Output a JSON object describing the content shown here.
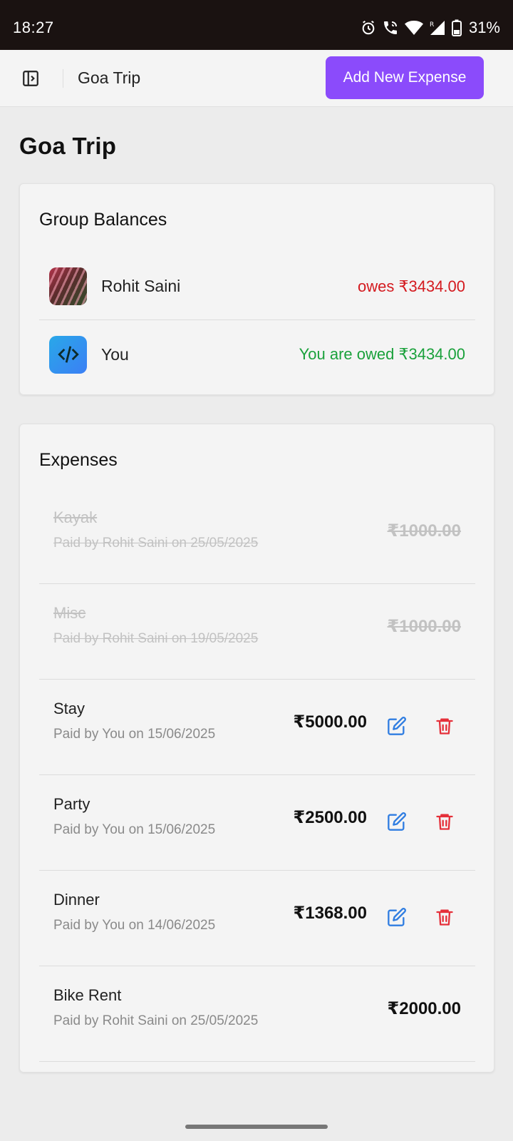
{
  "status_bar": {
    "time": "18:27",
    "battery": "31%",
    "icons": [
      "alarm-icon",
      "wifi-call-icon",
      "wifi-icon",
      "signal-icon",
      "battery-icon"
    ]
  },
  "header": {
    "sidebar_icon": "sidebar-toggle-icon",
    "title": "Goa Trip",
    "add_button": "Add New Expense",
    "accent_color": "#8b4bfb"
  },
  "page": {
    "title": "Goa Trip"
  },
  "balances": {
    "title": "Group Balances",
    "items": [
      {
        "name": "Rohit Saini",
        "status": "owes ₹3434.00",
        "color": "#d41a1f"
      },
      {
        "name": "You",
        "status": "You are owed ₹3434.00",
        "color": "#1aa13b"
      }
    ]
  },
  "expenses": {
    "title": "Expenses",
    "items": [
      {
        "name": "Kayak",
        "meta": "Paid by Rohit Saini on 25/05/2025",
        "amount": "₹1000.00",
        "settled": true,
        "editable": false
      },
      {
        "name": "Misc",
        "meta": "Paid by Rohit Saini on 19/05/2025",
        "amount": "₹1000.00",
        "settled": true,
        "editable": false
      },
      {
        "name": "Stay",
        "meta": "Paid by You on 15/06/2025",
        "amount": "₹5000.00",
        "settled": false,
        "editable": true
      },
      {
        "name": "Party",
        "meta": "Paid by You on 15/06/2025",
        "amount": "₹2500.00",
        "settled": false,
        "editable": true
      },
      {
        "name": "Dinner",
        "meta": "Paid by You on 14/06/2025",
        "amount": "₹1368.00",
        "settled": false,
        "editable": true
      },
      {
        "name": "Bike Rent",
        "meta": "Paid by Rohit Saini on 25/05/2025",
        "amount": "₹2000.00",
        "settled": false,
        "editable": false
      }
    ],
    "edit_icon": "edit-icon",
    "delete_icon": "trash-icon",
    "edit_color": "#2f7de1",
    "delete_color": "#e5303a"
  }
}
